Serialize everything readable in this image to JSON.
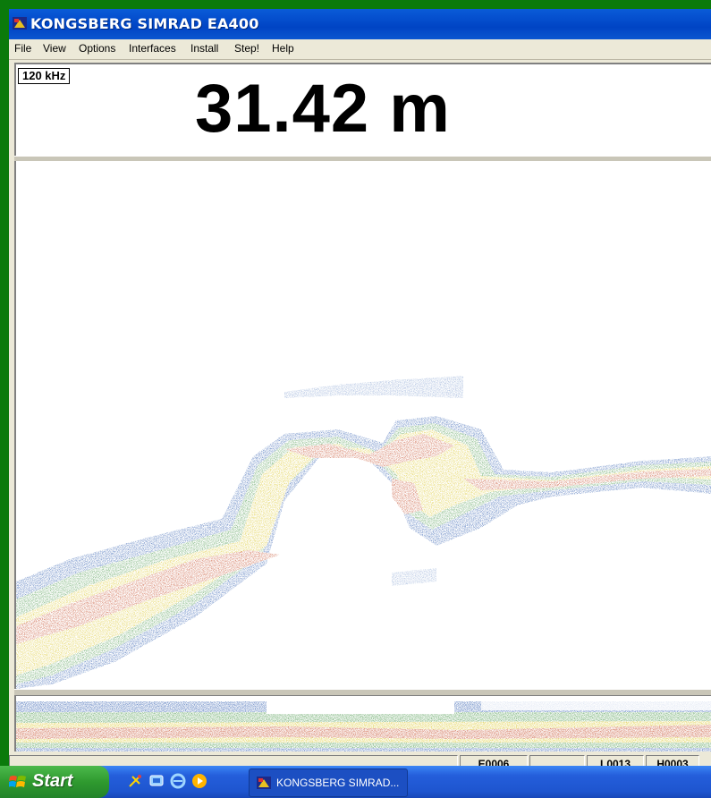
{
  "window": {
    "title": "KONGSBERG SIMRAD EA400"
  },
  "menu": [
    "File",
    "View",
    "Options",
    "Interfaces",
    "Install",
    "Step!",
    "Help"
  ],
  "readout": {
    "frequency": "120 kHz",
    "depth": "31.42 m"
  },
  "status": {
    "p1": "E0006",
    "p2": "",
    "p3": "L0013",
    "p4": "H0003"
  },
  "taskbar": {
    "start_label": "Start",
    "task_label": "KONGSBERG SIMRAD..."
  },
  "colors": {
    "echo_low": "#1f4fa8",
    "echo_mid": "#3d8f3d",
    "echo_high": "#d8c21a",
    "echo_peak": "#c0401c"
  }
}
